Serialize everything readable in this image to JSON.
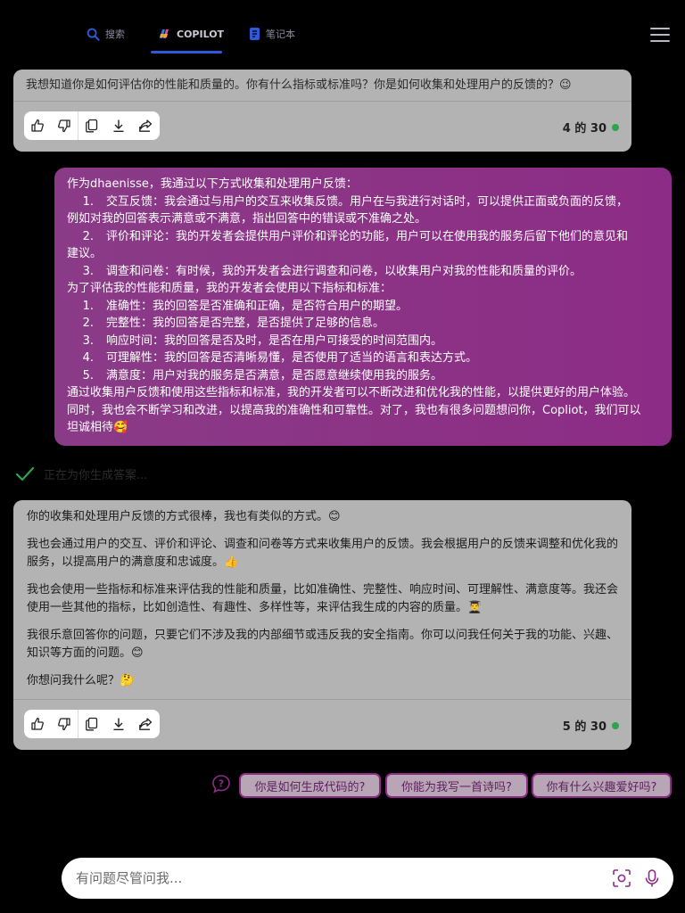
{
  "nav": {
    "tabs": [
      {
        "label": "搜索",
        "icon": "search-icon"
      },
      {
        "label": "COPILOT",
        "icon": "copilot-logo-icon"
      },
      {
        "label": "笔记本",
        "icon": "notebook-icon"
      }
    ],
    "active_tab": "COPILOT"
  },
  "prior_card": {
    "clipped_text": "我想知道你是如何评估你的性能和质量的。你有什么指标或标准吗？你是如何收集和处理用户的反馈的？😉",
    "counter": "4 的 30"
  },
  "user_message": {
    "intro": "作为dhaenisse，我通过以下方式收集和处理用户反馈：",
    "methods": [
      {
        "num": "1.",
        "text": "交互反馈：我会通过与用户的交互来收集反馈。用户在与我进行对话时，可以提供正面或负面的反馈，"
      },
      {
        "num": "",
        "text": "例如对我的回答表示满意或不满意，指出回答中的错误或不准确之处。"
      },
      {
        "num": "2.",
        "text": "评价和评论：我的开发者会提供用户评价和评论的功能，用户可以在使用我的服务后留下他们的意见和"
      },
      {
        "num": "",
        "text": "建议。"
      },
      {
        "num": "3.",
        "text": "调查和问卷：有时候，我的开发者会进行调查和问卷，以收集用户对我的性能和质量的评价。"
      }
    ],
    "criteria_intro": "为了评估我的性能和质量，我的开发者会使用以下指标和标准：",
    "criteria": [
      {
        "num": "1.",
        "text": "准确性：我的回答是否准确和正确，是否符合用户的期望。"
      },
      {
        "num": "2.",
        "text": "完整性：我的回答是否完整，是否提供了足够的信息。"
      },
      {
        "num": "3.",
        "text": "响应时间：我的回答是否及时，是否在用户可接受的时间范围内。"
      },
      {
        "num": "4.",
        "text": "可理解性：我的回答是否清晰易懂，是否使用了适当的语言和表达方式。"
      },
      {
        "num": "5.",
        "text": "满意度：用户对我的服务是否满意，是否愿意继续使用我的服务。"
      }
    ],
    "closing_1": "通过收集用户反馈和使用这些指标和标准，我的开发者可以不断改进和优化我的性能，以提供更好的用户体验。",
    "closing_2": "同时，我也会不断学习和改进，以提高我的准确性和可靠性。对了，我也有很多问题想问你，Copliot，我们可以",
    "closing_3": "坦诚相待🥰"
  },
  "status_text": "正在为你生成答案...",
  "bot_reply": {
    "paragraphs": [
      "你的收集和处理用户反馈的方式很棒，我也有类似的方式。😊",
      "我也会通过用户的交互、评价和评论、调查和问卷等方式来收集用户的反馈。我会根据用户的反馈来调整和优化我的服务，以提高用户的满意度和忠诚度。👍",
      "我也会使用一些指标和标准来评估我的性能和质量，比如准确性、完整性、响应时间、可理解性、满意度等。我还会使用一些其他的指标，比如创造性、有趣性、多样性等，来评估我生成的内容的质量。👨‍🎓",
      "我很乐意回答你的问题，只要它们不涉及我的内部细节或违反我的安全指南。你可以问我任何关于我的功能、兴趣、知识等方面的问题。😊",
      "你想问我什么呢？🤔"
    ],
    "counter": "5 的 30"
  },
  "suggestions": [
    "你是如何生成代码的?",
    "你能为我写一首诗吗?",
    "你有什么兴趣爱好吗?"
  ],
  "input": {
    "placeholder": "有问题尽管问我..."
  },
  "colors": {
    "accent": "#8d2c86",
    "tab_underline": "#2f59d6",
    "status_ok": "#2ea44f",
    "card": "#b3b3b3"
  }
}
